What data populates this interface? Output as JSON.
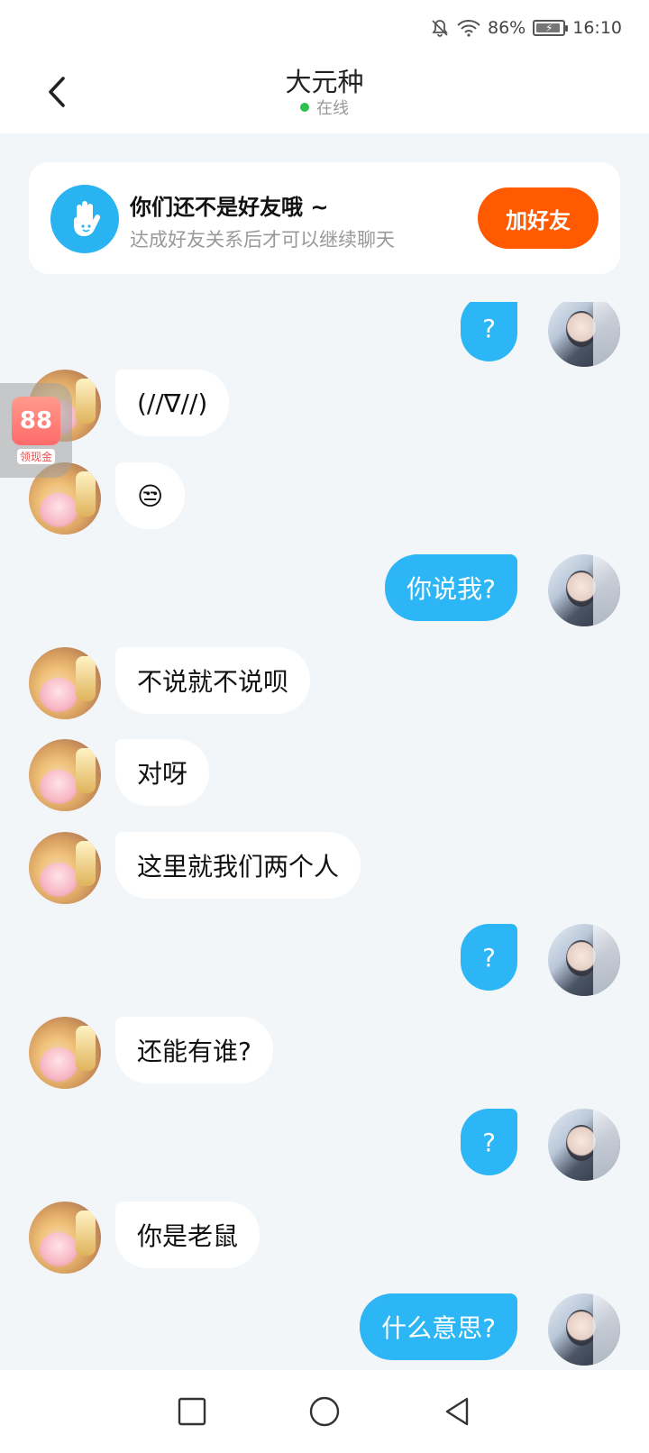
{
  "status_bar": {
    "battery_percent": "86%",
    "time": "16:10",
    "icons": [
      "bell-muted-icon",
      "wifi-icon",
      "battery-charging-icon"
    ]
  },
  "header": {
    "title": "大元种",
    "status": "在线",
    "status_color": "#2bc24c"
  },
  "friend_banner": {
    "icon": "waving-hand-icon",
    "title": "你们还不是好友哦 ~",
    "subtitle": "达成好友关系后才可以继续聊天",
    "button_label": "加好友",
    "button_color": "#ff5a00"
  },
  "floating_widget": {
    "label": "领现金",
    "icon_text": "88"
  },
  "messages": [
    {
      "from": "me",
      "text": "?"
    },
    {
      "from": "them",
      "text": "(//∇//)"
    },
    {
      "from": "them",
      "text": "😒"
    },
    {
      "from": "me",
      "text": "你说我?"
    },
    {
      "from": "them",
      "text": "不说就不说呗"
    },
    {
      "from": "them",
      "text": "对呀"
    },
    {
      "from": "them",
      "text": "这里就我们两个人"
    },
    {
      "from": "me",
      "text": "?"
    },
    {
      "from": "them",
      "text": "还能有谁?"
    },
    {
      "from": "me",
      "text": "?"
    },
    {
      "from": "them",
      "text": "你是老鼠"
    },
    {
      "from": "me",
      "text": "什么意思?"
    }
  ],
  "colors": {
    "my_bubble": "#2cb6f6",
    "their_bubble": "#ffffff",
    "background": "#f3f6f9"
  },
  "nav": [
    "recent-apps-icon",
    "home-icon",
    "back-icon"
  ]
}
